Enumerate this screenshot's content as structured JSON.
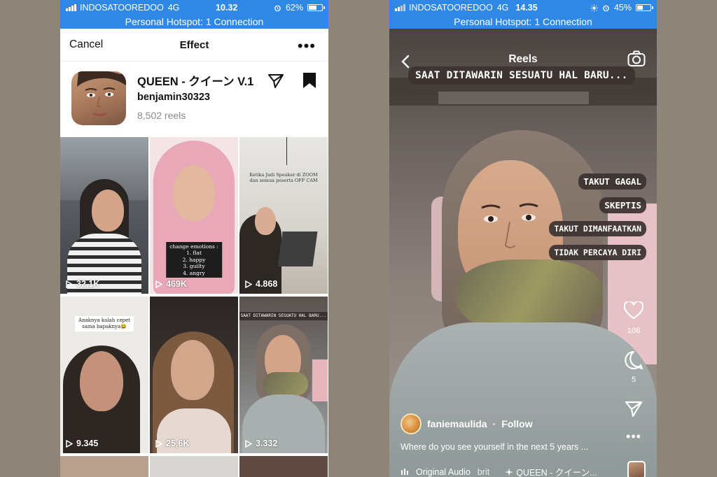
{
  "left": {
    "status": {
      "carrier": "INDOSATOOREDOO",
      "network": "4G",
      "time": "10.32",
      "battery_pct": "62%",
      "battery_fill": 0.62
    },
    "hotspot": "Personal Hotspot: 1 Connection",
    "nav": {
      "cancel": "Cancel",
      "title": "Effect",
      "more": "•••"
    },
    "effect": {
      "name": "QUEEN - クイーン V.1",
      "author": "benjamin30323",
      "reels": "8,502 reels"
    },
    "tiles": [
      {
        "plays": "32.1K",
        "caption": ""
      },
      {
        "plays": "469K",
        "caption": "change emotions :\n1. flat\n2. happy\n3. guilty\n4. angry"
      },
      {
        "plays": "4.868",
        "caption": "Ketika Jadi Speaker di ZOOM\ndan semua peserta OFF CAM"
      },
      {
        "plays": "9.345",
        "caption": "Anaknya kalah cepet\nsama bapaknya😂"
      },
      {
        "plays": "25,6K",
        "caption": ""
      },
      {
        "plays": "3.332",
        "caption": "SAAT DITAWARIN SESUATU HAL BARU..."
      }
    ]
  },
  "right": {
    "status": {
      "carrier": "INDOSATOOREDOO",
      "network": "4G",
      "time": "14.35",
      "battery_pct": "45%",
      "battery_fill": 0.45
    },
    "hotspot": "Personal Hotspot: 1 Connection",
    "header": {
      "title": "Reels"
    },
    "overlay_main": "SAAT DITAWARIN SESUATU HAL BARU...",
    "overlay_options": [
      "TAKUT GAGAL",
      "SKEPTIS",
      "TAKUT DIMANFAATKAN",
      "TIDAK PERCAYA DIRI"
    ],
    "likes": "108",
    "comments": "5",
    "author": {
      "name": "faniemaulida",
      "follow": "Follow"
    },
    "caption": "Where do you see yourself in the next 5 years ...",
    "audio": {
      "label": "Original Audio",
      "truncated": "brit",
      "effect": "QUEEN - クイーン..."
    }
  }
}
